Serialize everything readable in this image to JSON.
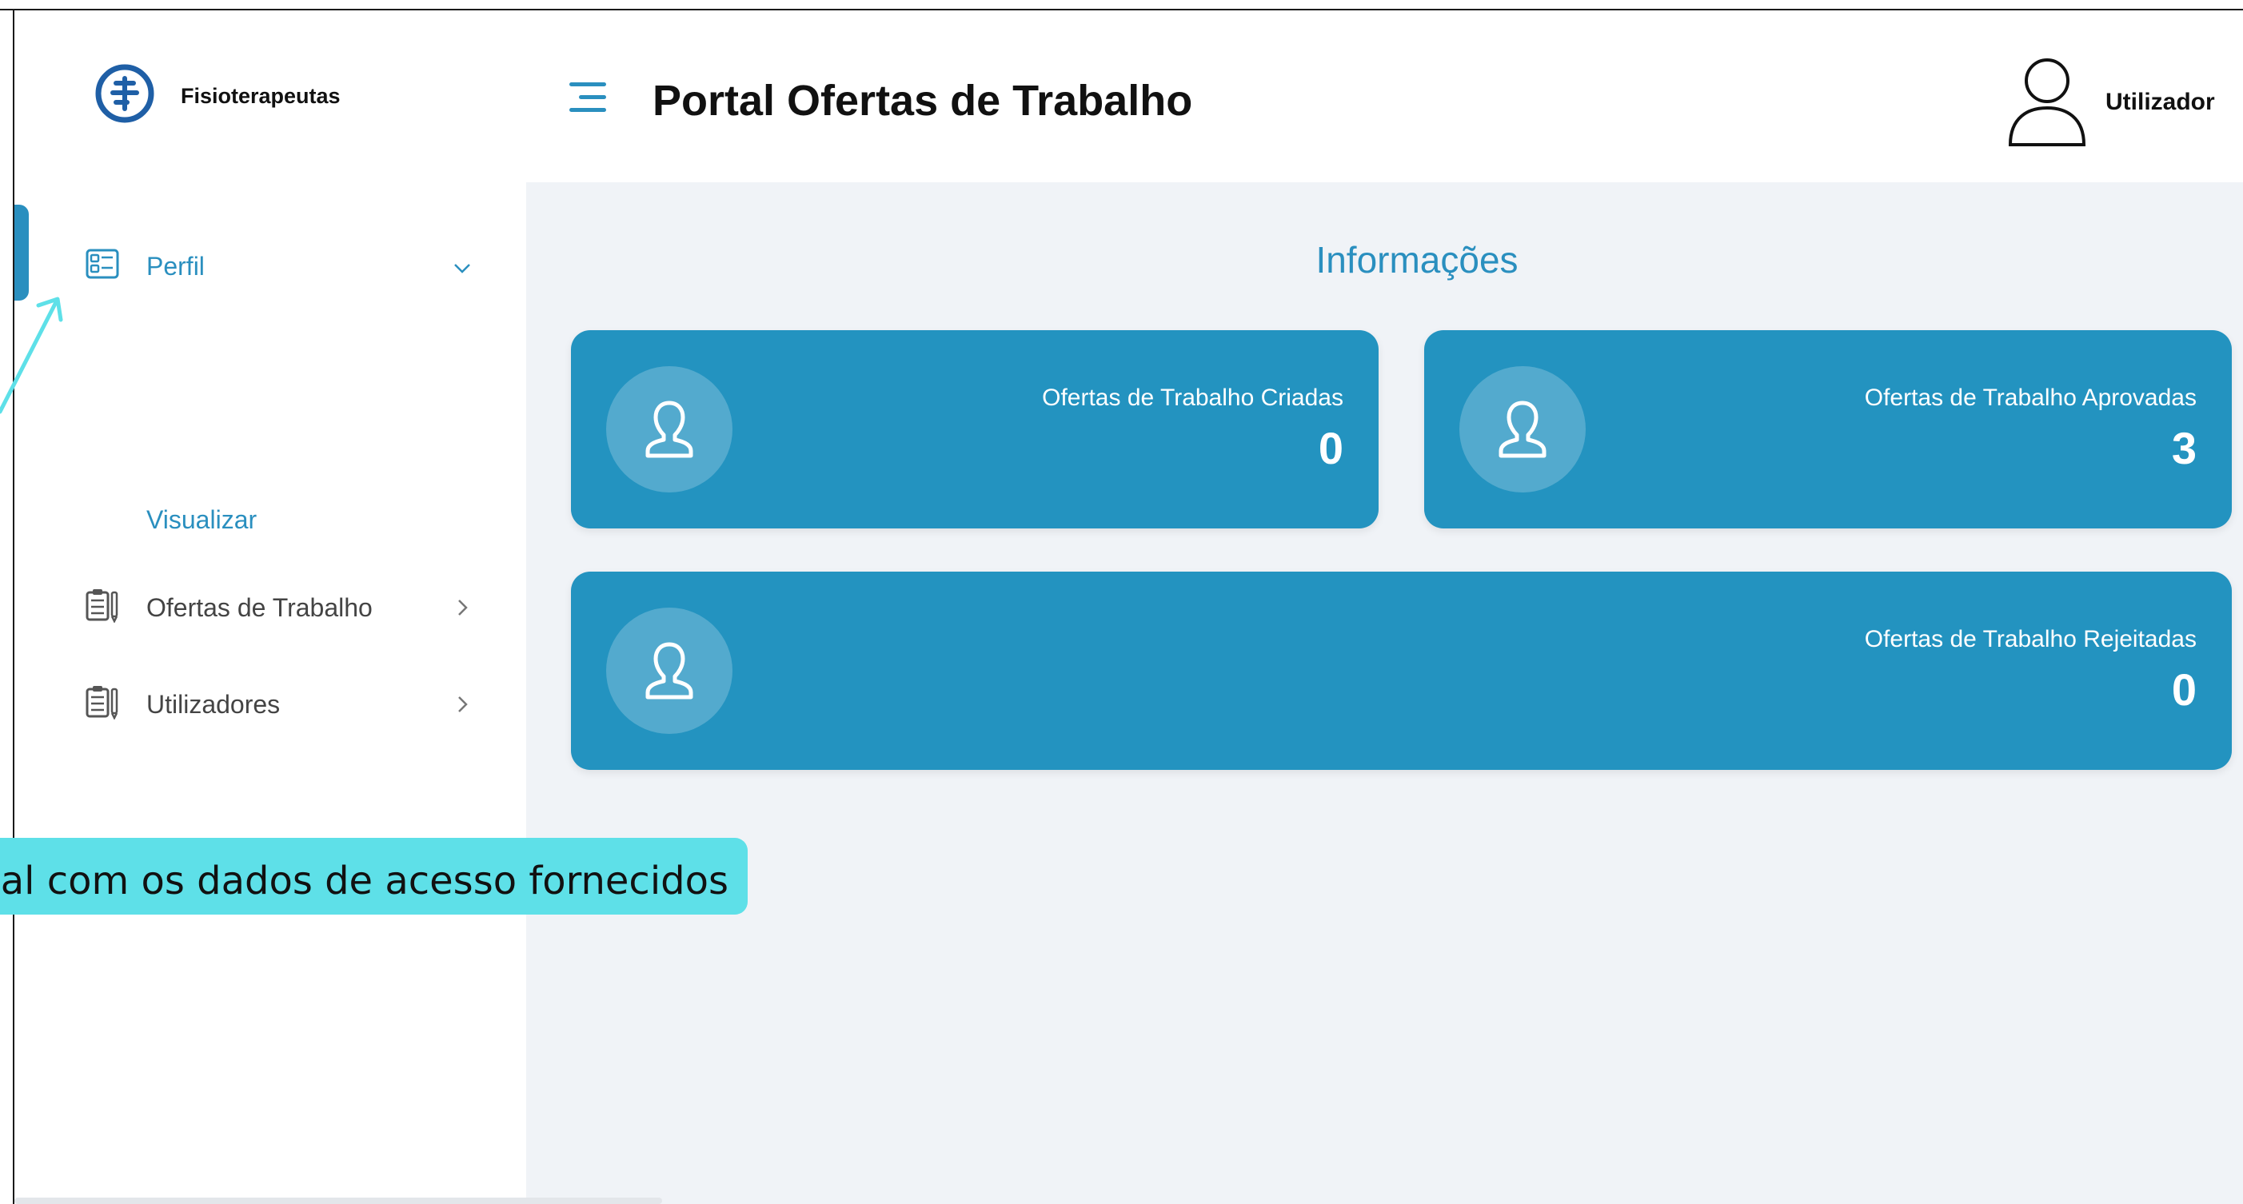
{
  "header": {
    "brand": "Fisioterapeutas",
    "title": "Portal Ofertas de Trabalho",
    "user": "Utilizador"
  },
  "sidebar": {
    "items": [
      {
        "label": "Perfil",
        "icon": "profile-card-icon",
        "expanded": true
      },
      {
        "label": "Ofertas de Trabalho",
        "icon": "clipboard-icon",
        "expanded": false
      },
      {
        "label": "Utilizadores",
        "icon": "clipboard-icon",
        "expanded": false
      }
    ],
    "sub_item": "Visualizar"
  },
  "main": {
    "section_title": "Informações",
    "cards": [
      {
        "label": "Ofertas de Trabalho Criadas",
        "value": "0",
        "icon": "person-icon"
      },
      {
        "label": "Ofertas de Trabalho Aprovadas",
        "value": "3",
        "icon": "person-icon"
      },
      {
        "label": "Ofertas de Trabalho Rejeitadas",
        "value": "0",
        "icon": "person-icon"
      }
    ]
  },
  "annotation": {
    "text": "al com os dados de acesso fornecidos"
  },
  "colors": {
    "accent": "#2a8fbf",
    "card": "#2393c0",
    "main_bg": "#f0f3f7",
    "annotation": "#5ee0e8"
  }
}
